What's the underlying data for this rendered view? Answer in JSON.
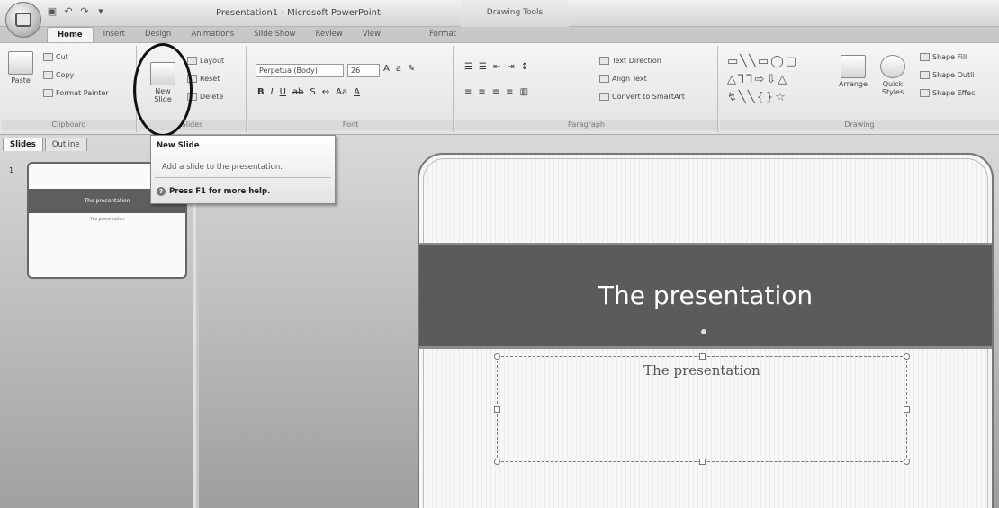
{
  "titlebar": {
    "title": "Presentation1 - Microsoft PowerPoint",
    "contextual_tab_group": "Drawing Tools"
  },
  "tabs": [
    {
      "label": "Home"
    },
    {
      "label": "Insert"
    },
    {
      "label": "Design"
    },
    {
      "label": "Animations"
    },
    {
      "label": "Slide Show"
    },
    {
      "label": "Review"
    },
    {
      "label": "View"
    },
    {
      "label": "Format"
    }
  ],
  "ribbon": {
    "clipboard": {
      "paste": "Paste",
      "cut": "Cut",
      "copy": "Copy",
      "format_painter": "Format Painter",
      "label": "Clipboard"
    },
    "slides": {
      "new_slide": "New",
      "new_slide_2": "Slide",
      "layout": "Layout",
      "reset": "Reset",
      "delete": "Delete",
      "label": "Slides"
    },
    "font": {
      "font_name": "Perpetua (Body)",
      "font_size": "26",
      "label": "Font"
    },
    "paragraph": {
      "text_direction": "Text Direction",
      "align_text": "Align Text",
      "convert_smartart": "Convert to SmartArt",
      "label": "Paragraph"
    },
    "drawing": {
      "arrange": "Arrange",
      "quick_styles": "Quick",
      "quick_styles_2": "Styles",
      "shape_fill": "Shape Fill",
      "shape_outline": "Shape Outli",
      "shape_effects": "Shape Effec",
      "label": "Drawing"
    }
  },
  "tooltip": {
    "title": "New Slide",
    "description": "Add a slide to the presentation.",
    "help": "Press F1 for more help."
  },
  "left_pane": {
    "tabs": [
      {
        "label": "Slides"
      },
      {
        "label": "Outline"
      }
    ],
    "slide_number": "1",
    "thumb_title": "The presentation",
    "thumb_subtitle": "The presentation"
  },
  "slide": {
    "title": "The presentation",
    "subtitle": "The presentation"
  }
}
